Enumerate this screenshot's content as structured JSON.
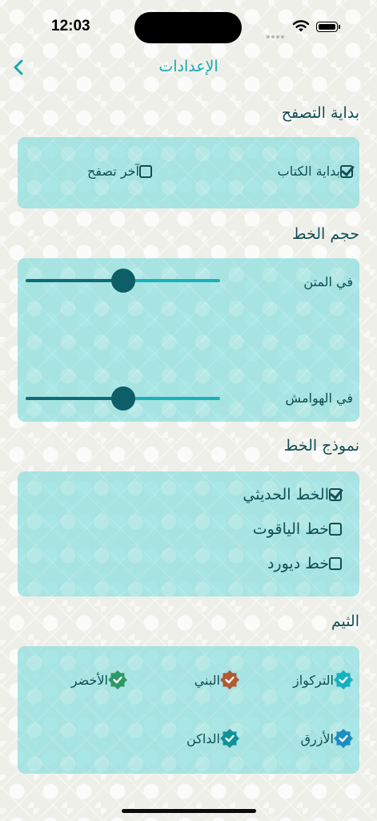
{
  "status": {
    "time": "12:03"
  },
  "nav": {
    "title": "الإعدادات"
  },
  "start": {
    "title": "بداية التصفح",
    "options": [
      {
        "label": "بداية الكتاب",
        "checked": true
      },
      {
        "label": "آخر تصفح",
        "checked": false
      }
    ]
  },
  "font_size": {
    "title": "حجم الخط",
    "sliders": [
      {
        "label": "في المتن",
        "value_fraction": 0.5
      },
      {
        "label": "في الهوامش",
        "value_fraction": 0.5
      }
    ]
  },
  "font_model": {
    "title": "نموذج الخط",
    "options": [
      {
        "label": "الخط الحديثي",
        "checked": true
      },
      {
        "label": "خط الياقوت",
        "checked": false
      },
      {
        "label": "خط ديورد",
        "checked": false
      }
    ]
  },
  "theme": {
    "title": "الثيم",
    "options": [
      {
        "label": "التركواز",
        "color": "#16b0c0",
        "selected": true
      },
      {
        "label": "البني",
        "color": "#b05a33",
        "selected": true
      },
      {
        "label": "الأخضر",
        "color": "#2f9966",
        "selected": true
      },
      {
        "label": "الأزرق",
        "color": "#1d8ec3",
        "selected": true
      },
      {
        "label": "الداكن",
        "color": "#11929a",
        "selected": true
      }
    ]
  },
  "colors": {
    "accent": "#15a9b3",
    "text": "#124f55",
    "card": "#89dede"
  }
}
